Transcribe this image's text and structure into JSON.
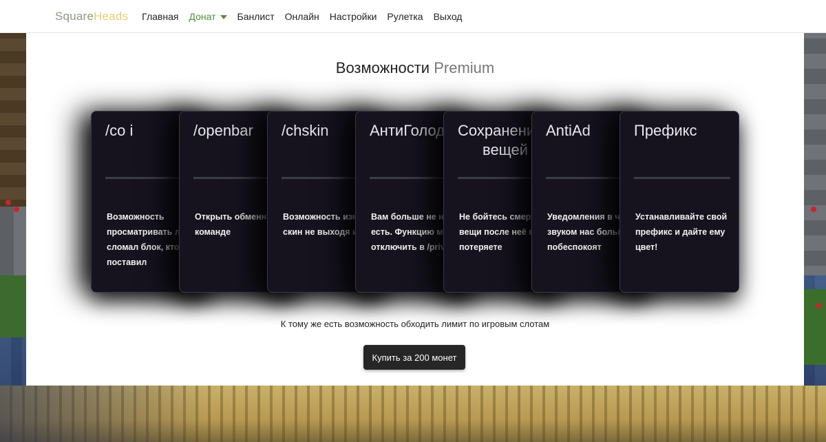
{
  "brand": {
    "part1": "Square",
    "part2": "Heads"
  },
  "nav": {
    "items": [
      {
        "label": "Главная"
      },
      {
        "label": "Донат"
      },
      {
        "label": "Банлист"
      },
      {
        "label": "Онлайн"
      },
      {
        "label": "Настройки"
      },
      {
        "label": "Рулетка"
      },
      {
        "label": "Выход"
      }
    ],
    "active_index": 1
  },
  "title": {
    "prefix": "Возможности ",
    "highlight": "Premium"
  },
  "cards": [
    {
      "title": "/co i",
      "text": "Возможность просматривать лог кто сломал блок, кто поставил"
    },
    {
      "title": "/openbar",
      "text": "Открыть обменник по команде"
    },
    {
      "title": "/chskin",
      "text": "Возможность изменить скин не выходя из игры"
    },
    {
      "title": "АнтиГолод",
      "text": "Вам больше не нужно есть. Функцию можно отключить в /privileges"
    },
    {
      "title_line1": "Сохранение",
      "title_line2": "вещей",
      "text": "Не бойтесь смерти, все вещи после неё вы не потеряете"
    },
    {
      "title": "AntiAd",
      "text": "Уведомления в чате со звуком нас больше не побеспокоят"
    },
    {
      "title": "Префикс",
      "text": "Устанавливайте свой префикс и дайте ему цвет!"
    }
  ],
  "footer_note": "К тому же есть возможность обходить лимит по игровым слотам",
  "buy_button": "Купить за 200 монет",
  "colors": {
    "card_bg": "#16131f",
    "active_nav": "#4c8f3a",
    "brand_accent": "#e4cf72"
  }
}
